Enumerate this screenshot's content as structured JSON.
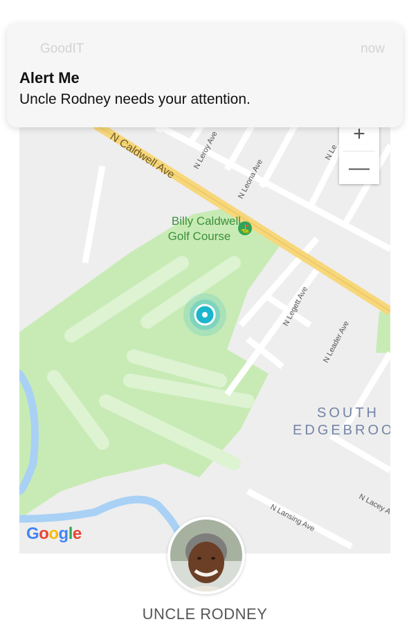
{
  "notification": {
    "app_name": "GoodIT",
    "time": "now",
    "title": "Alert Me",
    "message": "Uncle Rodney needs your attention."
  },
  "map": {
    "zoom_in_label": "+",
    "zoom_out_label": "—",
    "place_name_line1": "Billy Caldwell",
    "place_name_line2": "Golf Course",
    "area_label_line1": "SOUTH",
    "area_label_line2": "EDGEBROOK",
    "google_logo": "Google",
    "streets": {
      "caldwell": "N Caldwell Ave",
      "leroy": "N Leroy Ave",
      "leona": "N Leona Ave",
      "legett": "N Legett Ave",
      "leader": "N Leader Ave",
      "lacey": "N Lacey Ave",
      "lansing": "N Lansing Ave",
      "le": "N Le"
    },
    "colors": {
      "park": "#c8ebb5",
      "highway": "#f7d77a",
      "water": "#a9d1f5",
      "location": "#1bb6cc"
    }
  },
  "profile": {
    "name": "UNCLE RODNEY"
  }
}
